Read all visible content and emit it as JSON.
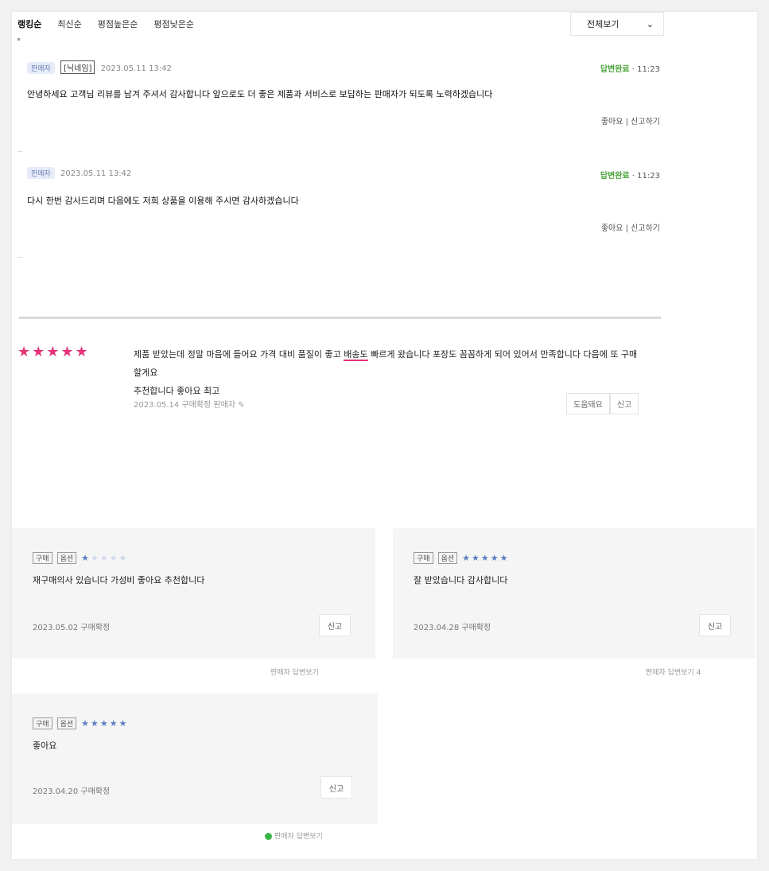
{
  "sort_tabs": [
    "랭킹순",
    "최신순",
    "평점높은순",
    "평점낮은순"
  ],
  "sort_select": {
    "label": "전체보기",
    "chevron": "chevron-down-icon"
  },
  "comments": [
    {
      "badge": "판매자",
      "author": "[닉네임]",
      "meta": "2023.05.11 13:42",
      "status_label": "답변완료",
      "status_time": "11:23",
      "text": "안녕하세요 고객님 리뷰를 남겨 주셔서 감사합니다 앞으로도 더 좋은 제품과 서비스로 보답하는 판매자가 되도록 노력하겠습니다",
      "actions": "좋아요 | 신고하기"
    },
    {
      "badge": "판매자",
      "author": "",
      "meta": "2023.05.11 13:42",
      "status_label": "답변완료",
      "status_time": "11:23",
      "text": "다시 한번 감사드리며 다음에도 저희 상품을 이용해 주시면 감사하겠습니다",
      "actions": "좋아요 | 신고하기"
    }
  ],
  "review": {
    "stars": "★★★★★",
    "text_line1_a": "제품 받았는데 정말 마음에 들어요 가격 대비 품질이 좋고 ",
    "text_line1_u": "배송도",
    "text_line1_b": " 빠르게 왔습니다 포장도 꼼꼼하게 되어 있어서 만족합니다 다음에 또 구매할게요",
    "text_line2": "추천합니다 좋아요 최고",
    "meta": "2023.05.14  구매확정  판매자",
    "btn_like": "도움돼요",
    "btn_report": "신고"
  },
  "sub_reviews": [
    {
      "label": "구매",
      "tag": "옵션",
      "stars_on": "★",
      "stars_off": "★★★★",
      "text": "재구매의사 있습니다 가성비 좋아요 추천합니다",
      "date": "2023.05.02 구매확정",
      "btn": "신고",
      "foot": "판매자 답변보기"
    },
    {
      "label": "구매",
      "tag": "옵션",
      "stars_on": "★★★★★",
      "stars_off": "",
      "text": "잘 받았습니다 감사합니다",
      "date": "2023.04.28 구매확정",
      "btn": "신고",
      "foot": "판매자 답변보기 4"
    },
    {
      "label": "구매",
      "tag": "옵션",
      "stars_on": "★★★★★",
      "stars_off": "",
      "text": "좋아요",
      "date": "2023.04.20 구매확정",
      "btn": "신고",
      "foot": "판매자 답변보기"
    }
  ]
}
